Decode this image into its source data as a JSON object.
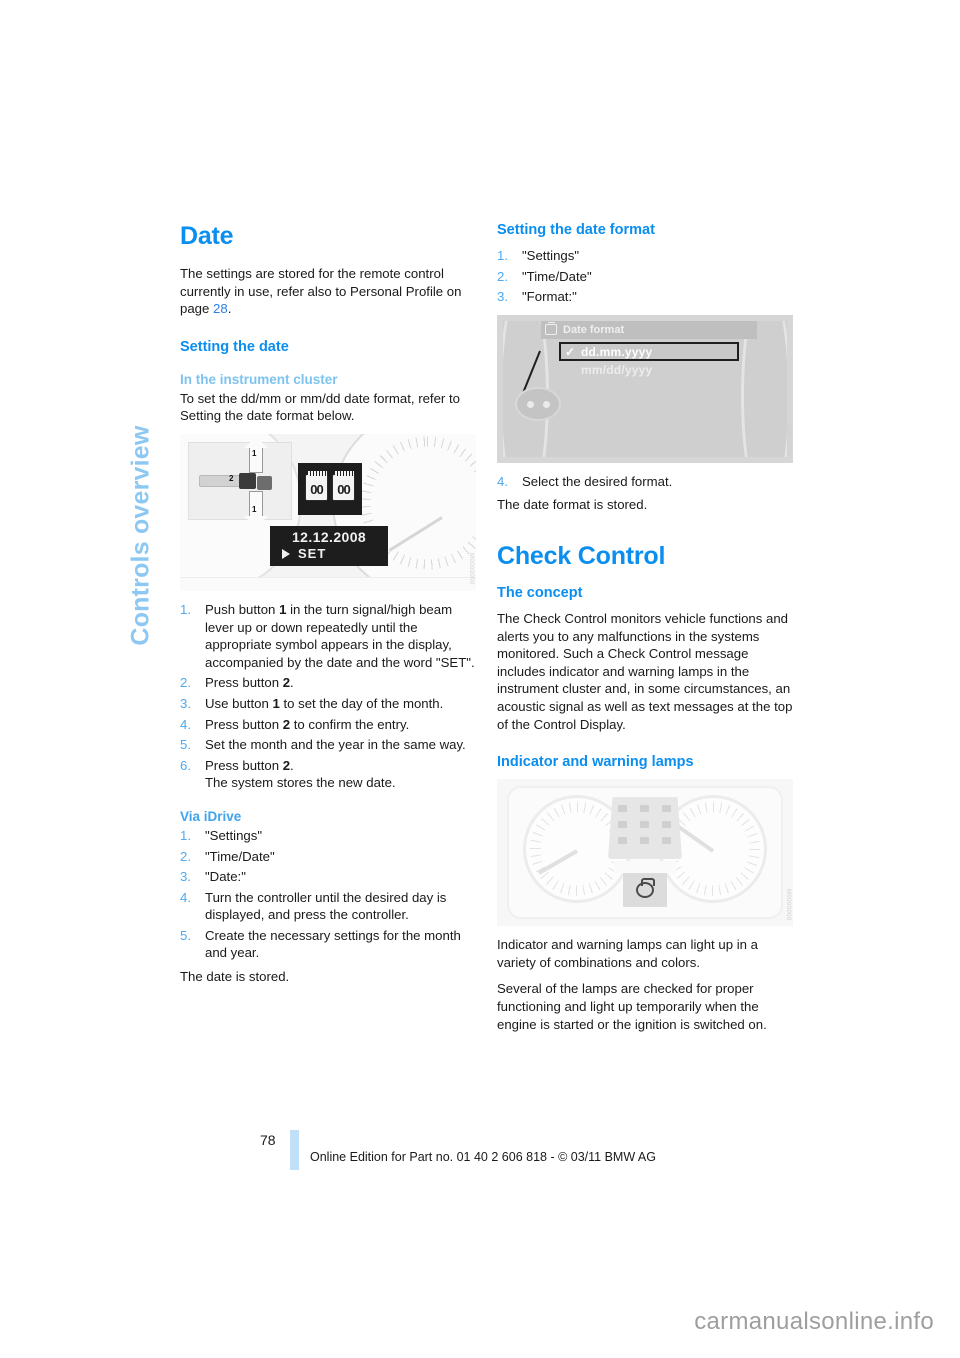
{
  "chapter_tab": {
    "label": "Controls overview"
  },
  "left_column": {
    "heading": "Date",
    "intro": "The settings are stored for the remote control currently in use, refer also to Personal Profile on page ",
    "intro_page_ref": "28",
    "intro_end": ".",
    "setting_the_date_heading": "Setting the date",
    "in_the_instrument_cluster_heading": "In the instrument cluster",
    "cluster_intro": "To set the dd/mm or mm/dd date format, refer to Setting the date format below.",
    "figure_cluster": {
      "caption_id": "M0000000",
      "date_display": "12.12.2008",
      "set_label": "SET",
      "segment_a": "00",
      "segment_b": "00",
      "lever_label_1_up": "1",
      "lever_label_1_down": "1",
      "lever_label_2": "2"
    },
    "cluster_steps": [
      {
        "num": "1.",
        "parts": [
          {
            "t": "Push button "
          },
          {
            "t": "1",
            "b": true
          },
          {
            "t": " in the turn signal/high beam lever up or down repeatedly until the appropriate symbol appears in the display, accompanied by the date and the word \"SET\"."
          }
        ]
      },
      {
        "num": "2.",
        "parts": [
          {
            "t": "Press button "
          },
          {
            "t": "2",
            "b": true
          },
          {
            "t": "."
          }
        ]
      },
      {
        "num": "3.",
        "parts": [
          {
            "t": "Use button "
          },
          {
            "t": "1",
            "b": true
          },
          {
            "t": " to set the day of the month."
          }
        ]
      },
      {
        "num": "4.",
        "parts": [
          {
            "t": "Press button "
          },
          {
            "t": "2",
            "b": true
          },
          {
            "t": " to confirm the entry."
          }
        ]
      },
      {
        "num": "5.",
        "parts": [
          {
            "t": "Set the month and the year in the same way."
          }
        ]
      },
      {
        "num": "6.",
        "parts": [
          {
            "t": "Press button "
          },
          {
            "t": "2",
            "b": true
          },
          {
            "t": ".\nThe system stores the new date."
          }
        ]
      }
    ],
    "via_idrive_heading": "Via iDrive",
    "idrive_steps": [
      {
        "num": "1.",
        "parts": [
          {
            "t": "\"Settings\""
          }
        ]
      },
      {
        "num": "2.",
        "parts": [
          {
            "t": "\"Time/Date\""
          }
        ]
      },
      {
        "num": "3.",
        "parts": [
          {
            "t": "\"Date:\""
          }
        ]
      },
      {
        "num": "4.",
        "parts": [
          {
            "t": "Turn the controller until the desired day is displayed, and press the controller."
          }
        ]
      },
      {
        "num": "5.",
        "parts": [
          {
            "t": "Create the necessary settings for the month and year."
          }
        ]
      }
    ],
    "date_stored": "The date is stored."
  },
  "right_column": {
    "setting_date_format_heading": "Setting the date format",
    "format_steps": [
      {
        "num": "1.",
        "parts": [
          {
            "t": "\"Settings\""
          }
        ]
      },
      {
        "num": "2.",
        "parts": [
          {
            "t": "\"Time/Date\""
          }
        ]
      },
      {
        "num": "3.",
        "parts": [
          {
            "t": "\"Format:\""
          }
        ]
      }
    ],
    "figure_idrive": {
      "caption_id": "M0000000",
      "menu_title": "Date format",
      "option_selected": "dd.mm.yyyy",
      "option_other": "mm/dd/yyyy",
      "check_glyph": "✓"
    },
    "format_steps_after": [
      {
        "num": "4.",
        "parts": [
          {
            "t": "Select the desired format."
          }
        ]
      }
    ],
    "format_stored": "The date format is stored.",
    "check_control_heading": "Check Control",
    "the_concept_heading": "The concept",
    "concept_text": "The Check Control monitors vehicle functions and alerts you to any malfunctions in the systems monitored. Such a Check Control message includes indicator and warning lamps in the instrument cluster and, in some circumstances, an acoustic signal as well as text messages at the top of the Control Display.",
    "indicator_lamps_heading": "Indicator and warning lamps",
    "figure_lamps": {
      "caption_id": "M0000000"
    },
    "lamps_text_1": "Indicator and warning lamps can light up in a variety of combinations and colors.",
    "lamps_text_2": "Several of the lamps are checked for proper functioning and light up temporarily when the engine is started or the ignition is switched on."
  },
  "footer": {
    "page_number": "78",
    "edition": "Online Edition for Part no. 01 40 2 606 818 - © 03/11 BMW AG"
  },
  "watermark": {
    "text": "carmanualsonline.info"
  },
  "colors": {
    "heading_blue": "#0a8ef0",
    "subheading_light_blue": "#7cc3f0",
    "tab_blue": "#8cc8f2",
    "list_number_blue": "#4ea9ef",
    "page_ref_blue": "#2f7fe0",
    "footer_bar": "#bfe0f8",
    "body_text": "#1a1a1a"
  }
}
